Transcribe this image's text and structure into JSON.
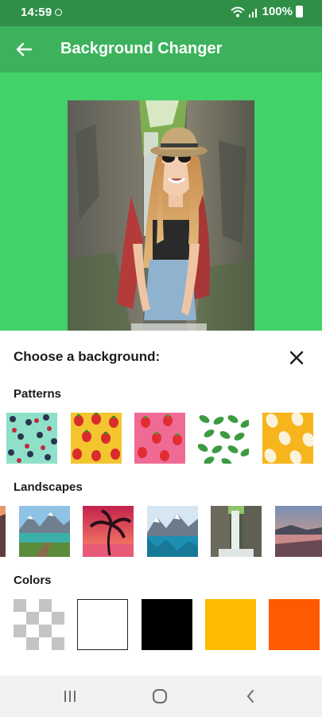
{
  "status_bar": {
    "time": "14:59",
    "battery": "100%"
  },
  "app_bar": {
    "title": "Background Changer"
  },
  "sheet": {
    "title": "Choose a background:",
    "patterns_label": "Patterns",
    "landscapes_label": "Landscapes",
    "colors_label": "Colors"
  },
  "patterns": [
    "blueberry-mint",
    "strawberry-yellow",
    "strawberry-pink",
    "green-leaves",
    "eggs-yellow"
  ],
  "landscapes": [
    "sunset-cliff",
    "mountain-lake-boardwalk",
    "palm-sunset",
    "glacier-lake",
    "waterfall",
    "sea-sunset"
  ],
  "colors": [
    "transparent",
    "#ffffff",
    "#000000",
    "#ffbb00",
    "#ff5a00"
  ],
  "theme": {
    "status_bar": "#2f8f47",
    "app_bar": "#3cb25c",
    "preview_bg": "#43d169"
  }
}
